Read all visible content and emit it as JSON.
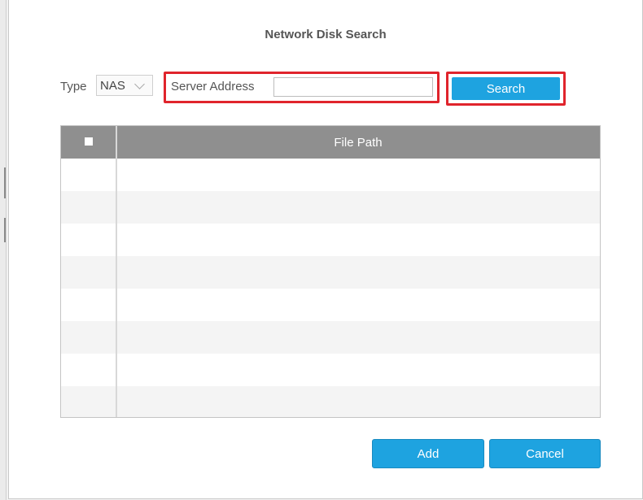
{
  "dialog": {
    "title": "Network Disk Search",
    "type_label": "Type",
    "type_value": "NAS",
    "server_address_label": "Server Address",
    "server_address_value": "",
    "search_label": "Search",
    "highlight_color": "#e0242c",
    "accent_color": "#1ea3e0"
  },
  "table": {
    "columns": [
      "",
      "File Path"
    ],
    "rows": []
  },
  "footer": {
    "add_label": "Add",
    "cancel_label": "Cancel"
  }
}
